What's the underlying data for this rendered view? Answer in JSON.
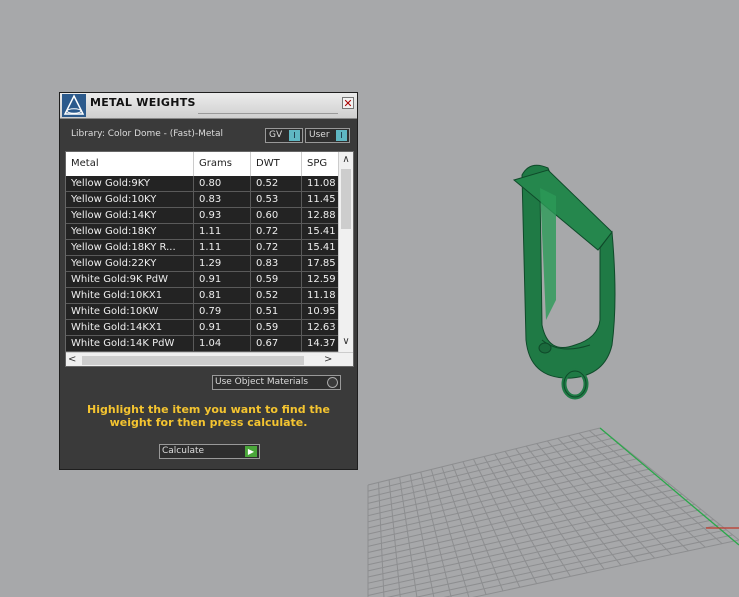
{
  "colors": {
    "viewport_bg": "#a7a8aa",
    "grid_line": "#8d8e90",
    "axis_red": "#c0392b",
    "axis_green": "#2aa84a",
    "model_green": "#1f7a45",
    "panel_bg": "#3a3a3a",
    "highlight_text": "#f4c430"
  },
  "panel": {
    "title": "METAL WEIGHTS",
    "close_glyph": "✕",
    "library_label": "Library: Color Dome - (Fast)-Metal",
    "gv_toggle": "GV",
    "user_toggle": "User",
    "toggle_knob": "I",
    "use_materials": "Use Object Materials",
    "instructions": "Highlight the item you want to find the weight for then press calculate.",
    "calculate_label": "Calculate",
    "calculate_icon": "play-icon"
  },
  "table": {
    "columns": [
      "Metal",
      "Grams",
      "DWT",
      "SPG"
    ],
    "rows": [
      [
        "Yellow Gold:9KY",
        "0.80",
        "0.52",
        "11.08"
      ],
      [
        "Yellow Gold:10KY",
        "0.83",
        "0.53",
        "11.45"
      ],
      [
        "Yellow Gold:14KY",
        "0.93",
        "0.60",
        "12.88"
      ],
      [
        "Yellow Gold:18KY",
        "1.11",
        "0.72",
        "15.41"
      ],
      [
        "Yellow Gold:18KY R...",
        "1.11",
        "0.72",
        "15.41"
      ],
      [
        "Yellow Gold:22KY",
        "1.29",
        "0.83",
        "17.85"
      ],
      [
        "White Gold:9K PdW",
        "0.91",
        "0.59",
        "12.59"
      ],
      [
        "White Gold:10KX1",
        "0.81",
        "0.52",
        "11.18"
      ],
      [
        "White Gold:10KW",
        "0.79",
        "0.51",
        "10.95"
      ],
      [
        "White Gold:14KX1",
        "0.91",
        "0.59",
        "12.63"
      ],
      [
        "White Gold:14K PdW",
        "1.04",
        "0.67",
        "14.37"
      ]
    ],
    "scroll_up": "∧",
    "scroll_down": "∨",
    "scroll_left": "<",
    "scroll_right": ">"
  }
}
